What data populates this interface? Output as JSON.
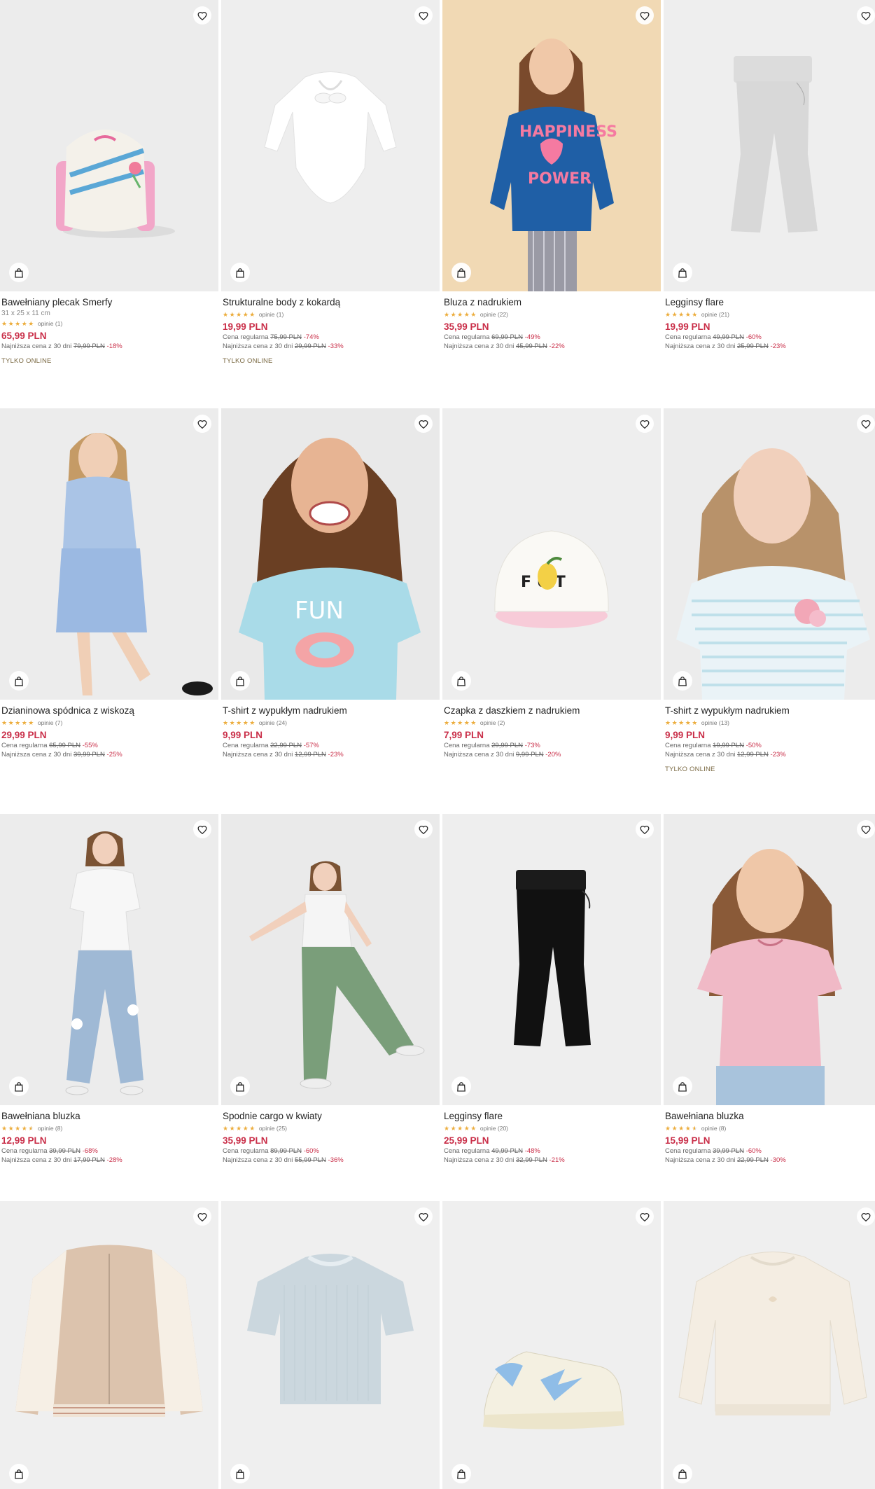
{
  "labels": {
    "regular": "Cena regularna",
    "lowest": "Najniższa cena z 30 dni",
    "online_only": "TYLKO ONLINE"
  },
  "products": [
    {
      "name": "Bawełniany plecak Smerfy",
      "dims": "31 x 25 x 11 cm",
      "rating": 5,
      "reviews": "opinie (1)",
      "price": "65,99 PLN",
      "regular": "",
      "regular_disc": "",
      "lowest": "79,99 PLN",
      "lowest_disc": "-18%",
      "online": true,
      "bg": "#ececec",
      "icon": "backpack-image"
    },
    {
      "name": "Strukturalne body z kokardą",
      "dims": "",
      "rating": 5,
      "reviews": "opinie (1)",
      "price": "19,99 PLN",
      "regular": "75,99 PLN",
      "regular_disc": "-74%",
      "lowest": "29,99 PLN",
      "lowest_disc": "-33%",
      "online": true,
      "bg": "#eeeeee",
      "icon": "bodysuit-image"
    },
    {
      "name": "Bluza z nadrukiem",
      "dims": "",
      "rating": 5,
      "reviews": "opinie (22)",
      "price": "35,99 PLN",
      "regular": "69,99 PLN",
      "regular_disc": "-49%",
      "lowest": "45,99 PLN",
      "lowest_disc": "-22%",
      "online": false,
      "bg": "#f1d9b4",
      "icon": "girl-sweatshirt-image"
    },
    {
      "name": "Legginsy flare",
      "dims": "",
      "rating": 5,
      "reviews": "opinie (21)",
      "price": "19,99 PLN",
      "regular": "49,99 PLN",
      "regular_disc": "-60%",
      "lowest": "25,99 PLN",
      "lowest_disc": "-23%",
      "online": false,
      "bg": "#eeeeee",
      "icon": "grey-leggings-image"
    },
    {
      "name": "Dzianinowa spódnica z wiskozą",
      "dims": "",
      "rating": 5,
      "reviews": "opinie (7)",
      "price": "29,99 PLN",
      "regular": "65,99 PLN",
      "regular_disc": "-55%",
      "lowest": "39,99 PLN",
      "lowest_disc": "-25%",
      "online": false,
      "bg": "#ececec",
      "icon": "girl-skirt-image"
    },
    {
      "name": "T-shirt z wypukłym nadrukiem",
      "dims": "",
      "rating": 5,
      "reviews": "opinie (24)",
      "price": "9,99 PLN",
      "regular": "22,99 PLN",
      "regular_disc": "-57%",
      "lowest": "12,99 PLN",
      "lowest_disc": "-23%",
      "online": false,
      "bg": "#e9e9e9",
      "icon": "girl-tshirt-image"
    },
    {
      "name": "Czapka z daszkiem z nadrukiem",
      "dims": "",
      "rating": 5,
      "reviews": "opinie (2)",
      "price": "7,99 PLN",
      "regular": "29,99 PLN",
      "regular_disc": "-73%",
      "lowest": "9,99 PLN",
      "lowest_disc": "-20%",
      "online": false,
      "bg": "#eeeeee",
      "icon": "cap-image"
    },
    {
      "name": "T-shirt z wypukłym nadrukiem",
      "dims": "",
      "rating": 5,
      "reviews": "opinie (13)",
      "price": "9,99 PLN",
      "regular": "19,99 PLN",
      "regular_disc": "-50%",
      "lowest": "12,99 PLN",
      "lowest_disc": "-23%",
      "online": true,
      "bg": "#ececec",
      "icon": "girl-striped-tshirt-image"
    },
    {
      "name": "Bawełniana bluzka",
      "dims": "",
      "rating": 4.5,
      "reviews": "opinie (8)",
      "price": "12,99 PLN",
      "regular": "39,99 PLN",
      "regular_disc": "-68%",
      "lowest": "17,99 PLN",
      "lowest_disc": "-28%",
      "online": false,
      "bg": "#ececec",
      "icon": "girl-jeans-image"
    },
    {
      "name": "Spodnie cargo w kwiaty",
      "dims": "",
      "rating": 5,
      "reviews": "opinie (25)",
      "price": "35,99 PLN",
      "regular": "89,99 PLN",
      "regular_disc": "-60%",
      "lowest": "55,99 PLN",
      "lowest_disc": "-36%",
      "online": false,
      "bg": "#eaeaea",
      "icon": "girl-cargo-image"
    },
    {
      "name": "Legginsy flare",
      "dims": "",
      "rating": 5,
      "reviews": "opinie (20)",
      "price": "25,99 PLN",
      "regular": "49,99 PLN",
      "regular_disc": "-48%",
      "lowest": "32,99 PLN",
      "lowest_disc": "-21%",
      "online": false,
      "bg": "#eeeeee",
      "icon": "black-leggings-image"
    },
    {
      "name": "Bawełniana bluzka",
      "dims": "",
      "rating": 4.5,
      "reviews": "opinie (8)",
      "price": "15,99 PLN",
      "regular": "39,99 PLN",
      "regular_disc": "-60%",
      "lowest": "22,99 PLN",
      "lowest_disc": "-30%",
      "online": false,
      "bg": "#ececec",
      "icon": "girl-pink-top-image"
    },
    {
      "name": "",
      "dims": "",
      "rating": 0,
      "reviews": "",
      "price": "",
      "regular": "",
      "regular_disc": "",
      "lowest": "",
      "lowest_disc": "",
      "online": false,
      "bg": "#efefef",
      "icon": "bomber-jacket-image"
    },
    {
      "name": "",
      "dims": "",
      "rating": 0,
      "reviews": "",
      "price": "",
      "regular": "",
      "regular_disc": "",
      "lowest": "",
      "lowest_disc": "",
      "online": false,
      "bg": "#efefef",
      "icon": "ribbed-tshirt-image"
    },
    {
      "name": "",
      "dims": "",
      "rating": 0,
      "reviews": "",
      "price": "",
      "regular": "",
      "regular_disc": "",
      "lowest": "",
      "lowest_disc": "",
      "online": false,
      "bg": "#efefef",
      "icon": "sneaker-image"
    },
    {
      "name": "",
      "dims": "",
      "rating": 0,
      "reviews": "",
      "price": "",
      "regular": "",
      "regular_disc": "",
      "lowest": "",
      "lowest_disc": "",
      "online": false,
      "bg": "#efefef",
      "icon": "cream-sweatshirt-image"
    }
  ]
}
